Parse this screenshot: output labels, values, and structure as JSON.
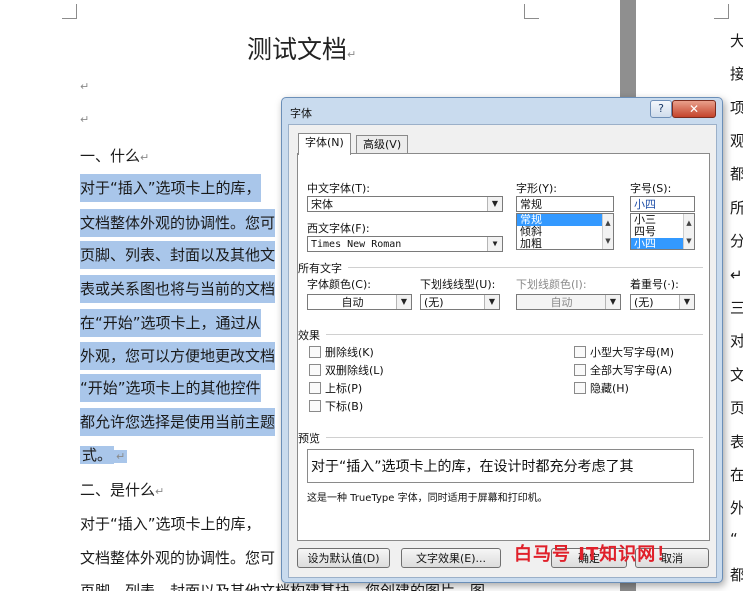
{
  "document": {
    "title": "测试文档",
    "para_mark": "↵",
    "heading1": "一、什么",
    "selected_lines": [
      "对于“插入”选项卡上的库，",
      "文档整体外观的协调性。您可",
      "页脚、列表、封面以及其他文",
      "表或关系图也将与当前的文档",
      "在“开始”选项卡上，通过从",
      "外观，您可以方便地更改文档",
      "“开始”选项卡上的其他控件",
      "都允许您选择是使用当前主题",
      "式。"
    ],
    "heading2": "二、是什么",
    "body_lines": [
      "对于“插入”选项卡上的库，",
      "文档整体外观的协调性。您可",
      "页脚、列表、封面以及其他文档构建基块。您创建的图片、图"
    ],
    "right_column_chars": [
      "大",
      "接",
      "项",
      "观",
      "都",
      "所",
      "分",
      "↵",
      "三",
      "对",
      "文",
      "页",
      "表",
      "在",
      "外",
      "“",
      "都"
    ]
  },
  "dialog": {
    "title": "字体",
    "help_label": "?",
    "close_label": "✕",
    "tabs": [
      {
        "label": "字体(N)",
        "active": true
      },
      {
        "label": "高级(V)",
        "active": false
      }
    ],
    "chinese_font": {
      "label": "中文字体(T):",
      "value": "宋体"
    },
    "western_font": {
      "label": "西文字体(F):",
      "value": "Times New Roman"
    },
    "font_style": {
      "label": "字形(Y):",
      "value": "常规",
      "options": [
        "常规",
        "倾斜",
        "加粗"
      ],
      "selected": "常规"
    },
    "font_size": {
      "label": "字号(S):",
      "value": "小四",
      "options": [
        "小三",
        "四号",
        "小四"
      ],
      "selected": "小四"
    },
    "all_text": {
      "section_label": "所有文字",
      "font_color": {
        "label": "字体颜色(C):",
        "value": "自动"
      },
      "underline_type": {
        "label": "下划线线型(U):",
        "value": "(无)"
      },
      "underline_color": {
        "label": "下划线颜色(I):",
        "value": "自动"
      },
      "emphasis_mark": {
        "label": "着重号(·):",
        "value": "(无)"
      }
    },
    "effects": {
      "section_label": "效果",
      "left": [
        "删除线(K)",
        "双删除线(L)",
        "上标(P)",
        "下标(B)"
      ],
      "right": [
        "小型大写字母(M)",
        "全部大写字母(A)",
        "隐藏(H)"
      ]
    },
    "preview": {
      "section_label": "预览",
      "sample_text": "对于“插入”选项卡上的库，在设计时都充分考虑了其",
      "note": "这是一种 TrueType 字体，同时适用于屏幕和打印机。"
    },
    "buttons": {
      "set_default": "设为默认值(D)",
      "text_effects": "文字效果(E)...",
      "ok": "确定",
      "cancel": "取消"
    }
  },
  "watermark": "白马号 IT知识网！"
}
